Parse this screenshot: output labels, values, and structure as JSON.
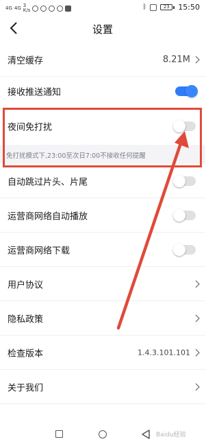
{
  "status_bar": {
    "left_signal_1": "4G",
    "left_signal_2": "4G",
    "speed_value": "3",
    "speed_unit": "K/s",
    "time": "15:50",
    "battery": "23"
  },
  "header": {
    "title": "设置"
  },
  "rows": {
    "clear_cache": {
      "label": "清空缓存",
      "value": "8.21M"
    },
    "push": {
      "label": "接收推送通知",
      "enabled": true
    },
    "dnd": {
      "label": "夜间免打扰",
      "enabled": false,
      "hint": "免打扰模式下,23:00至次日7:00不接收任何提醒"
    },
    "auto_skip": {
      "label": "自动跳过片头、片尾",
      "enabled": false
    },
    "carrier_autoplay": {
      "label": "运营商网络自动播放",
      "enabled": false
    },
    "carrier_download": {
      "label": "运营商网络下载",
      "enabled": false
    },
    "user_agreement": {
      "label": "用户协议"
    },
    "privacy": {
      "label": "隐私政策"
    },
    "version": {
      "label": "检查版本",
      "value": "1.4.3.101.101"
    },
    "about": {
      "label": "关于我们"
    }
  },
  "colors": {
    "accent": "#2f7cf6",
    "highlight_box": "#e04a3a",
    "hint_bg": "#f4f4f6"
  },
  "watermark": "Baidu经验"
}
